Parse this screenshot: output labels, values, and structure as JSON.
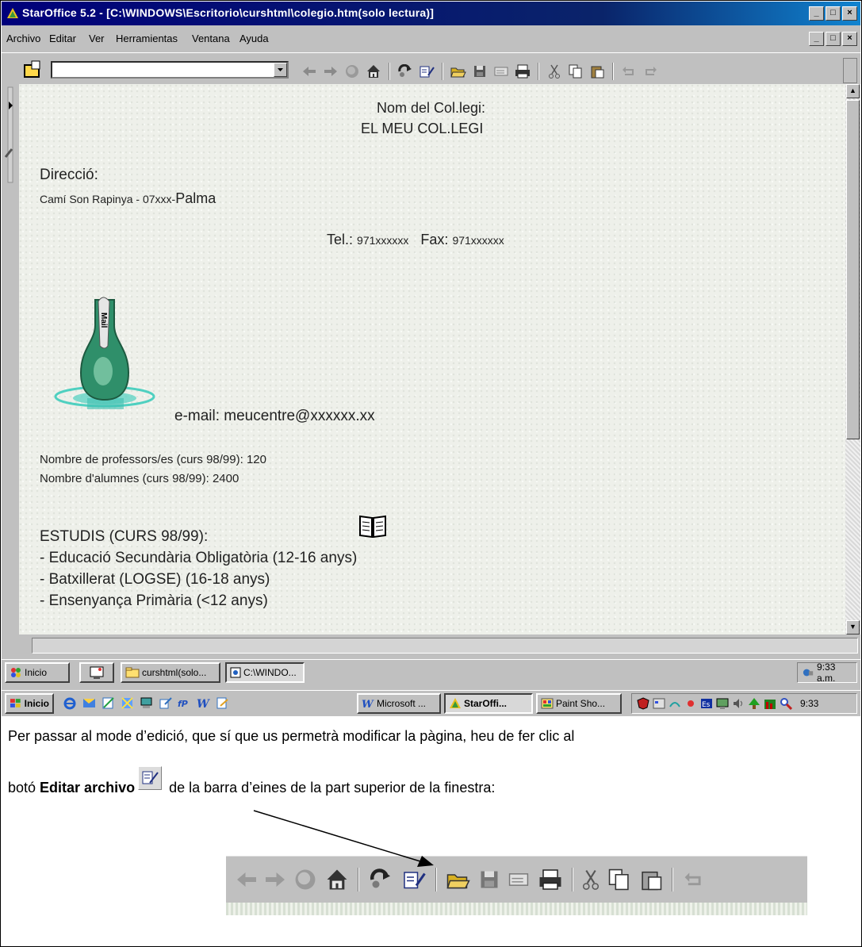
{
  "window": {
    "title": "StarOffice 5.2 - [C:\\WINDOWS\\Escritorio\\curshtml\\colegio.htm(solo lectura)]",
    "title_buttons": [
      "_",
      "□",
      "×"
    ]
  },
  "menu": {
    "items": [
      "Archivo",
      "Editar",
      "Ver",
      "Herramientas",
      "Ventana",
      "Ayuda"
    ]
  },
  "page": {
    "school_label": "Nom del Col.legi:",
    "school_name": "EL MEU COL.LEGI",
    "address_label": "Direcció:",
    "address_value": "Camí Son Rapinya - 07xxx-",
    "address_city": "Palma",
    "tel_label": "Tel.:",
    "tel_value": "971xxxxxx",
    "fax_label": "Fax:",
    "fax_value": "971xxxxxx",
    "bottle_label": "Mail",
    "email": "e-mail: meucentre@xxxxxx.xx",
    "teachers": "Nombre de professors/es (curs 98/99): 120",
    "students": "Nombre d'alumnes (curs 98/99): 2400",
    "studies_title": "ESTUDIS (CURS 98/99):",
    "studies": [
      "- Educació Secundària Obligatòria (12-16 anys)",
      "- Batxillerat (LOGSE) (16-18 anys)",
      "- Ensenyança Primària (<12 anys)"
    ]
  },
  "taskbar1": {
    "start": "Inicio",
    "buttons": [
      "curshtml(solo...",
      "C:\\WINDO..."
    ],
    "clock": "9:33 a.m."
  },
  "taskbar2": {
    "start": "Inicio",
    "buttons": [
      "Microsoft ...",
      "StarOffi...",
      "Paint Sho..."
    ],
    "clock": "9:33"
  },
  "instructions": {
    "line1": "Per passar al mode d’edició, que sí que us permetrà modificar la pàgina, heu de fer clic al",
    "line2_pre": "botó ",
    "line2_bold": "Editar archivo",
    "line2_post": " de la barra d’eines de la part superior de la finestra:"
  },
  "colors": {
    "titlebar": "#00007b",
    "chrome": "#c0c0c0",
    "page_background": "#eef0ea",
    "bottle": "#2f8f6a",
    "water": "#4fd0c0"
  },
  "icons": [
    "back-arrow-icon",
    "forward-arrow-icon",
    "stop-icon",
    "home-icon",
    "reload-icon",
    "edit-file-icon",
    "open-folder-icon",
    "save-icon",
    "send-icon",
    "print-icon",
    "cut-icon",
    "copy-icon",
    "paste-icon",
    "undo-icon",
    "redo-icon"
  ]
}
